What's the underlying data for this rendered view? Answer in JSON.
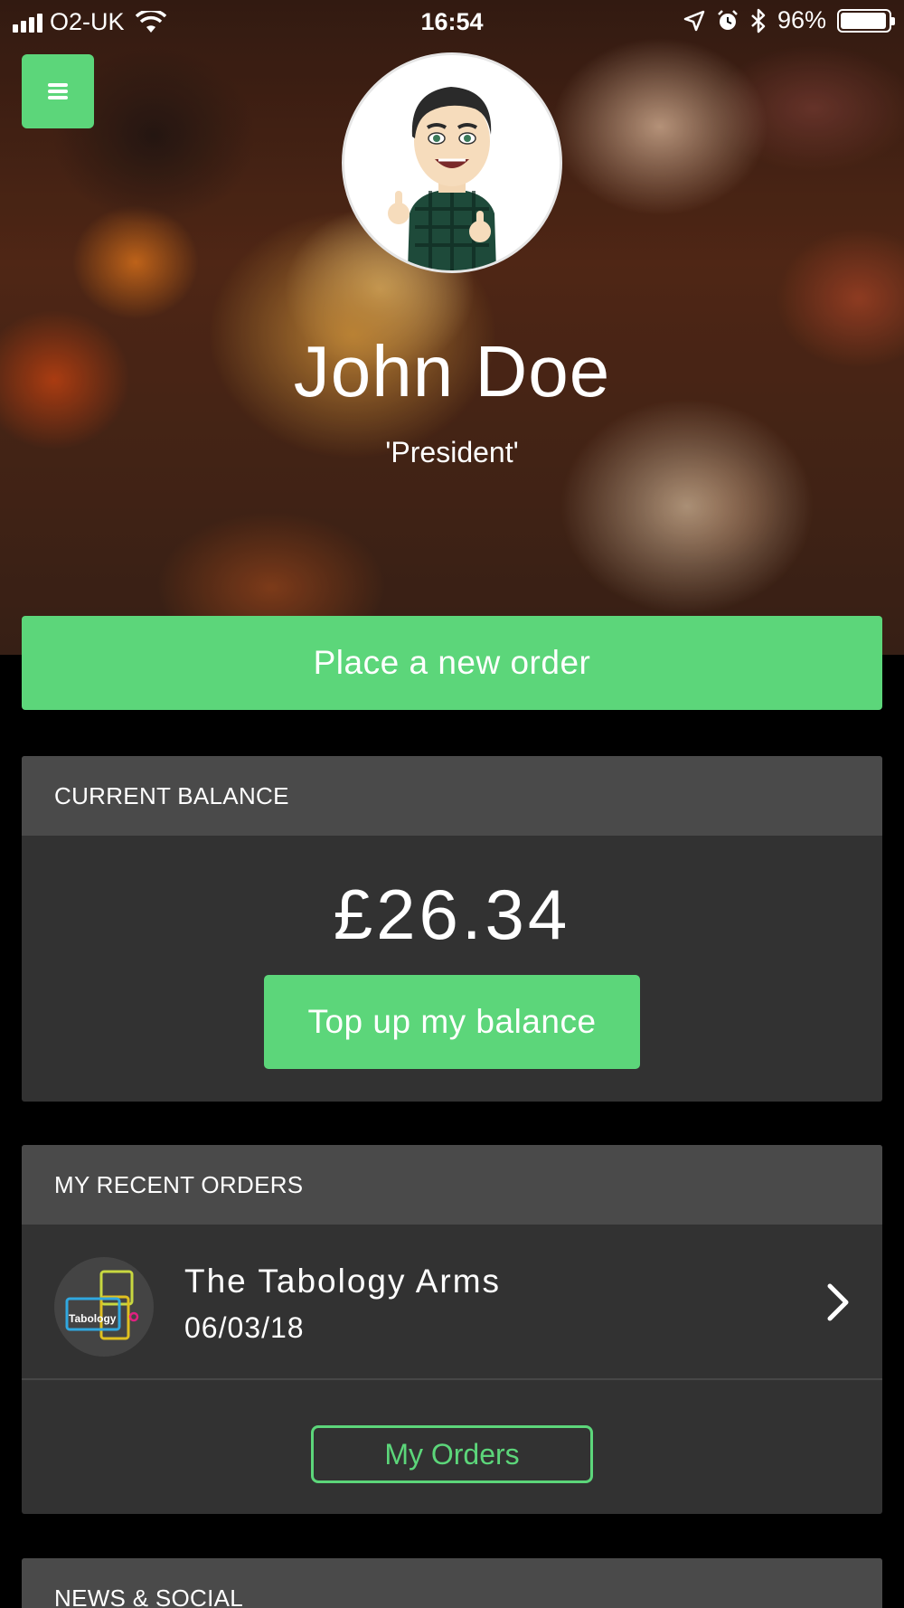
{
  "status_bar": {
    "carrier": "O2-UK",
    "time": "16:54",
    "battery": "96%",
    "battery_level": 0.96
  },
  "profile": {
    "name": "John Doe",
    "title": "'President'"
  },
  "actions": {
    "place_order": "Place a new order"
  },
  "balance": {
    "header": "CURRENT BALANCE",
    "amount": "£26.34",
    "topup": "Top up my balance"
  },
  "recent_orders": {
    "header": "MY RECENT ORDERS",
    "items": [
      {
        "venue": "The Tabology Arms",
        "date": "06/03/18",
        "logo_text": "Tabology"
      }
    ],
    "my_orders": "My Orders"
  },
  "news": {
    "header": "NEWS & SOCIAL"
  },
  "colors": {
    "accent": "#5cd67a",
    "card": "#323232",
    "card_header": "#4a4a4a",
    "background": "#000000"
  }
}
